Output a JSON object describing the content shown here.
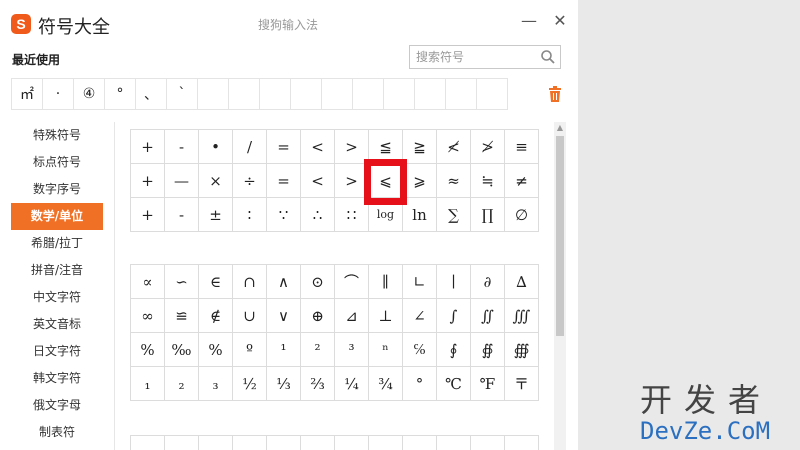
{
  "titlebar": {
    "app_name": "符号大全",
    "center_title": "搜狗输入法",
    "logo_letter": "S",
    "minimize_label": "—",
    "close_label": "✕"
  },
  "recent": {
    "label": "最近使用",
    "items": [
      "㎡",
      "·",
      "④",
      "°",
      "、",
      "`",
      "",
      "",
      "",
      "",
      "",
      "",
      "",
      "",
      "",
      ""
    ]
  },
  "search": {
    "placeholder": "搜索符号"
  },
  "sidebar": {
    "items": [
      {
        "label": "特殊符号"
      },
      {
        "label": "标点符号"
      },
      {
        "label": "数字序号"
      },
      {
        "label": "数学/单位",
        "active": true
      },
      {
        "label": "希腊/拉丁"
      },
      {
        "label": "拼音/注音"
      },
      {
        "label": "中文字符"
      },
      {
        "label": "英文音标"
      },
      {
        "label": "日文字符"
      },
      {
        "label": "韩文字符"
      },
      {
        "label": "俄文字母"
      },
      {
        "label": "制表符"
      }
    ]
  },
  "grid1": [
    "+",
    "-",
    "•",
    "/",
    "=",
    "<",
    ">",
    "≦",
    "≧",
    "≮",
    "≯",
    "≡",
    "+",
    "—",
    "×",
    "÷",
    "=",
    "<",
    ">",
    "⩽",
    "⩾",
    "≈",
    "≒",
    "≠",
    "+",
    "-",
    "±",
    "∶",
    "∵",
    "∴",
    "∷",
    "log",
    "ln",
    "∑",
    "∏",
    "∅"
  ],
  "grid2": [
    "∝",
    "∽",
    "∈",
    "∩",
    "∧",
    "⊙",
    "⌒",
    "∥",
    "∟",
    "∣",
    "∂",
    "∆",
    "∞",
    "≌",
    "∉",
    "∪",
    "∨",
    "⊕",
    "⊿",
    "⊥",
    "∠",
    "∫",
    "∬",
    "∭",
    "%",
    "‰",
    "%",
    "º",
    "¹",
    "²",
    "³",
    "ⁿ",
    "℅",
    "∮",
    "∯",
    "∰",
    "₁",
    "₂",
    "₃",
    "½",
    "⅓",
    "⅔",
    "¼",
    "¾",
    "°",
    "℃",
    "℉",
    "〒"
  ],
  "grid3": [
    "",
    "",
    "",
    "",
    "",
    "",
    "",
    "",
    "",
    "",
    "",
    ""
  ],
  "watermark": {
    "top": "开发者",
    "bottom": "DevZe.CoM"
  },
  "colors": {
    "accent": "#f07126",
    "highlight": "#e6101b",
    "logo": "#f05a1a"
  }
}
